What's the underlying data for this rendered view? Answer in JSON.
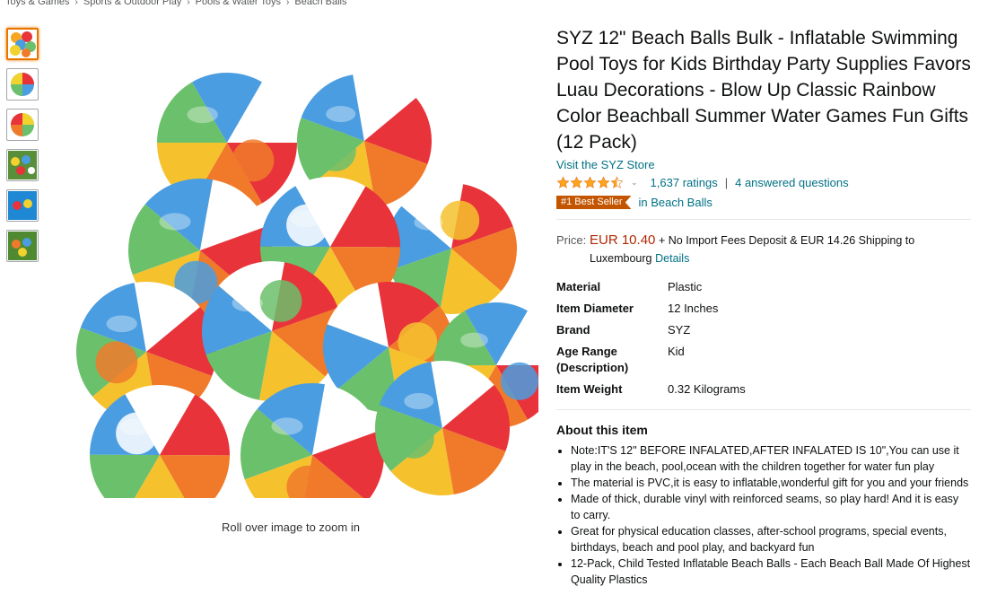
{
  "breadcrumb": [
    "Toys & Games",
    "Sports & Outdoor Play",
    "Pools & Water Toys",
    "Beach Balls"
  ],
  "zoom_hint": "Roll over image to zoom in",
  "product": {
    "title": "SYZ 12\" Beach Balls Bulk - Inflatable Swimming Pool Toys for Kids Birthday Party Supplies Favors Luau Decorations - Blow Up Classic Rainbow Color Beachball Summer Water Games Fun Gifts (12 Pack)",
    "store_link": "Visit the SYZ Store",
    "rating_value": 4.5,
    "ratings_count": "1,637 ratings",
    "answered": "4 answered questions",
    "badge": "#1 Best Seller",
    "badge_category": "in Beach Balls",
    "price_label": "Price:",
    "price": "EUR 10.40",
    "shipping": "+ No Import Fees Deposit & EUR 14.26 Shipping to Luxembourg",
    "details_link": "Details"
  },
  "specs": [
    {
      "k": "Material",
      "v": "Plastic"
    },
    {
      "k": "Item Diameter",
      "v": "12 Inches"
    },
    {
      "k": "Brand",
      "v": "SYZ"
    },
    {
      "k": "Age Range (Description)",
      "v": "Kid"
    },
    {
      "k": "Item Weight",
      "v": "0.32 Kilograms"
    }
  ],
  "about": {
    "title": "About this item",
    "bullets": [
      "Note:IT'S 12\" BEFORE INFALATED,AFTER INFALATED IS 10\",You can use it play in the beach, pool,ocean with the children together for water fun play",
      "The material is PVC,it is easy to inflatable,wonderful gift for you and your friends",
      "Made of thick, durable vinyl with reinforced seams, so play hard! And it is easy to carry.",
      "Great for physical education classes, after-school programs, special events, birthdays, beach and pool play, and backyard fun",
      "12-Pack, Child Tested Inflatable Beach Balls - Each Beach Ball Made Of Highest Quality Plastics"
    ]
  },
  "colors": {
    "link": "#007185",
    "price": "#b12704",
    "badge": "#c45500",
    "star": "#ffa41c"
  }
}
